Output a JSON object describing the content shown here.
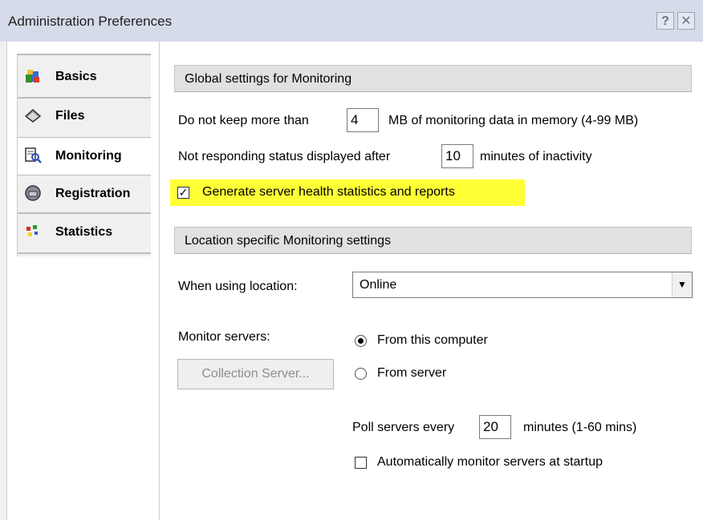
{
  "window": {
    "title": "Administration Preferences",
    "help_label": "?",
    "close_label": "✕"
  },
  "sidebar": {
    "items": [
      {
        "label": "Basics",
        "icon": "basics-icon",
        "active": false
      },
      {
        "label": "Files",
        "icon": "files-icon",
        "active": false
      },
      {
        "label": "Monitoring",
        "icon": "monitoring-icon",
        "active": true
      },
      {
        "label": "Registration",
        "icon": "registration-icon",
        "active": false
      },
      {
        "label": "Statistics",
        "icon": "statistics-icon",
        "active": false
      }
    ]
  },
  "global_section": {
    "header": "Global settings for Monitoring",
    "keep_prefix": "Do not keep more than",
    "keep_value": "4",
    "keep_suffix": "MB of monitoring data in memory (4-99 MB)",
    "status_prefix": "Not responding status displayed after",
    "status_value": "10",
    "status_suffix": "minutes of inactivity",
    "health_checked": true,
    "health_label": "Generate server health statistics and reports",
    "highlight_color": "#ffff36"
  },
  "location_section": {
    "header": "Location specific Monitoring settings",
    "location_label": "When using location:",
    "location_value": "Online",
    "monitor_label": "Monitor servers:",
    "collection_button": "Collection Server...",
    "radio_options": [
      {
        "label": "From this computer",
        "checked": true
      },
      {
        "label": "From server",
        "checked": false
      }
    ],
    "poll_prefix": "Poll servers every",
    "poll_value": "20",
    "poll_suffix": "minutes (1-60 mins)",
    "auto_checked": false,
    "auto_label": "Automatically monitor servers at startup"
  }
}
